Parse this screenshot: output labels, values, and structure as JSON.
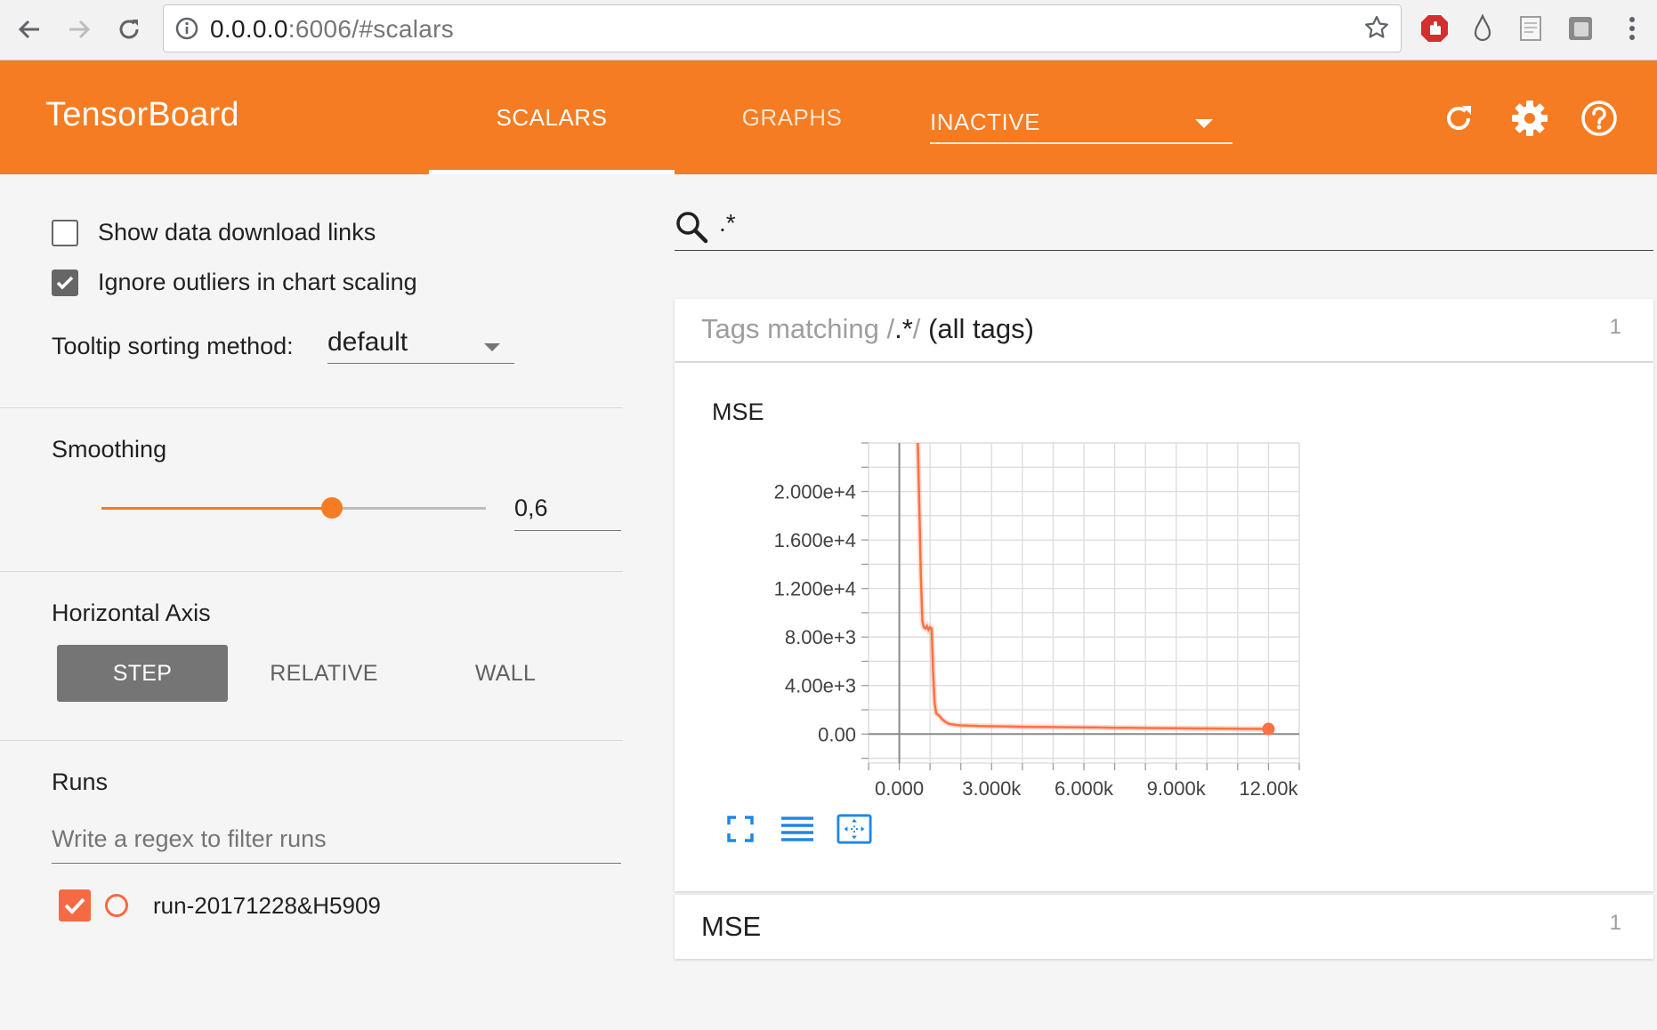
{
  "browser": {
    "url_host": "0.0.0.0",
    "url_rest": ":6006/#scalars"
  },
  "header": {
    "title": "TensorBoard",
    "tabs": [
      {
        "label": "SCALARS",
        "active": true
      },
      {
        "label": "GRAPHS",
        "active": false
      }
    ],
    "inactive_dropdown": "INACTIVE",
    "accent_color": "#f57c22"
  },
  "sidebar": {
    "show_download_links": {
      "label": "Show data download links",
      "checked": false
    },
    "ignore_outliers": {
      "label": "Ignore outliers in chart scaling",
      "checked": true
    },
    "tooltip_sorting": {
      "label": "Tooltip sorting method:",
      "value": "default"
    },
    "smoothing": {
      "title": "Smoothing",
      "value": 0.6,
      "display": "0,6"
    },
    "horizontal_axis": {
      "title": "Horizontal Axis",
      "options": [
        "STEP",
        "RELATIVE",
        "WALL"
      ],
      "selected": "STEP"
    },
    "runs": {
      "title": "Runs",
      "filter_placeholder": "Write a regex to filter runs",
      "items": [
        {
          "label": "run-20171228&H5909",
          "checked": true,
          "color": "#f66a43"
        }
      ]
    }
  },
  "main": {
    "search_value": ".*",
    "tag_group": {
      "prefix": "Tags matching /",
      "pattern": ".*",
      "suffix": "/",
      "all_tags": "(all tags)",
      "count": "1"
    },
    "mse_group": {
      "title": "MSE",
      "count": "1"
    }
  },
  "chart_data": {
    "type": "line",
    "title": "MSE",
    "xlabel": "",
    "ylabel": "",
    "x_tick_labels": [
      "0.000",
      "3.000k",
      "6.000k",
      "9.000k",
      "12.00k"
    ],
    "x_ticks": [
      0,
      3000,
      6000,
      9000,
      12000
    ],
    "y_tick_labels": [
      "0.00",
      "4.00e+3",
      "8.00e+3",
      "1.200e+4",
      "1.600e+4",
      "2.000e+4"
    ],
    "y_ticks": [
      0,
      4000,
      8000,
      12000,
      16000,
      20000
    ],
    "xlim": [
      -1000,
      13000
    ],
    "ylim": [
      -2400,
      24000
    ],
    "grid": true,
    "series": [
      {
        "name": "run-20171228&H5909",
        "color": "#ff7043",
        "x": [
          600,
          650,
          700,
          750,
          800,
          850,
          900,
          950,
          1000,
          1050,
          1100,
          1150,
          1200,
          1300,
          1400,
          1500,
          1600,
          1800,
          2000,
          2300,
          2600,
          3000,
          3500,
          4000,
          4500,
          5000,
          5500,
          6000,
          6500,
          7000,
          7500,
          8000,
          8500,
          9000,
          9500,
          10000,
          10500,
          11000,
          11500,
          12000
        ],
        "y": [
          24000,
          19000,
          13000,
          9300,
          8800,
          8700,
          8900,
          8600,
          8800,
          8700,
          5000,
          2500,
          1700,
          1500,
          1200,
          1000,
          850,
          760,
          720,
          690,
          660,
          640,
          620,
          600,
          590,
          580,
          560,
          550,
          540,
          520,
          510,
          500,
          490,
          480,
          470,
          460,
          450,
          440,
          430,
          420
        ]
      }
    ]
  }
}
